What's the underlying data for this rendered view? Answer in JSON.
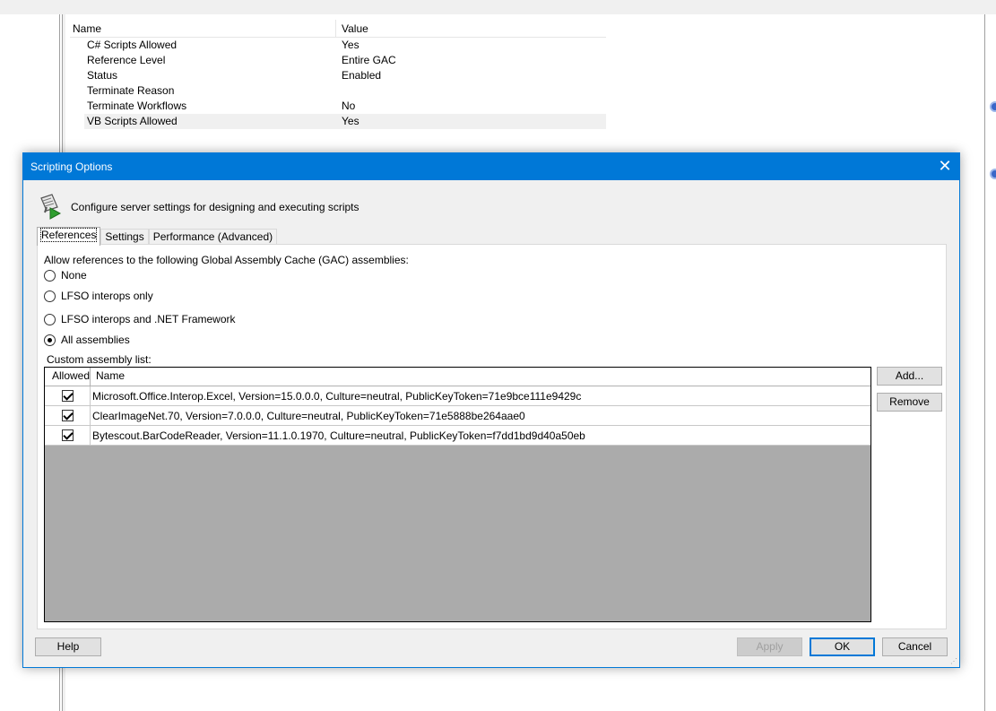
{
  "background": {
    "properties": {
      "col_name": "Name",
      "col_value": "Value",
      "rows": [
        {
          "name": "C# Scripts Allowed",
          "value": "Yes"
        },
        {
          "name": "Reference Level",
          "value": "Entire GAC"
        },
        {
          "name": "Status",
          "value": "Enabled"
        },
        {
          "name": "Terminate Reason",
          "value": ""
        },
        {
          "name": "Terminate Workflows",
          "value": "No"
        },
        {
          "name": "VB Scripts Allowed",
          "value": "Yes"
        }
      ]
    }
  },
  "dialog": {
    "title": "Scripting Options",
    "close_glyph": "✕",
    "header_text": "Configure server settings for designing and executing scripts",
    "tabs": [
      {
        "label": "References",
        "active": true
      },
      {
        "label": "Settings",
        "active": false
      },
      {
        "label": "Performance (Advanced)",
        "active": false
      }
    ],
    "references": {
      "gac_label": "Allow references to the following Global Assembly Cache (GAC) assemblies:",
      "options": [
        {
          "label": "None",
          "checked": false
        },
        {
          "label": "LFSO interops only",
          "checked": false
        },
        {
          "label": "LFSO interops and .NET Framework",
          "checked": false
        },
        {
          "label": "All assemblies",
          "checked": true
        }
      ],
      "custom_label": "Custom assembly list:",
      "columns": {
        "allowed": "Allowed",
        "name": "Name"
      },
      "assemblies": [
        {
          "allowed": true,
          "name": "Microsoft.Office.Interop.Excel, Version=15.0.0.0, Culture=neutral, PublicKeyToken=71e9bce111e9429c"
        },
        {
          "allowed": true,
          "name": "ClearImageNet.70, Version=7.0.0.0, Culture=neutral, PublicKeyToken=71e5888be264aae0"
        },
        {
          "allowed": true,
          "name": "Bytescout.BarCodeReader, Version=11.1.0.1970, Culture=neutral, PublicKeyToken=f7dd1bd9d40a50eb"
        }
      ],
      "add_label": "Add...",
      "remove_label": "Remove"
    },
    "buttons": {
      "help": "Help",
      "apply": "Apply",
      "ok": "OK",
      "cancel": "Cancel"
    }
  },
  "colors": {
    "accent": "#0078d7",
    "list_empty_area": "#ababab",
    "dialog_bg": "#f0f0f0"
  }
}
